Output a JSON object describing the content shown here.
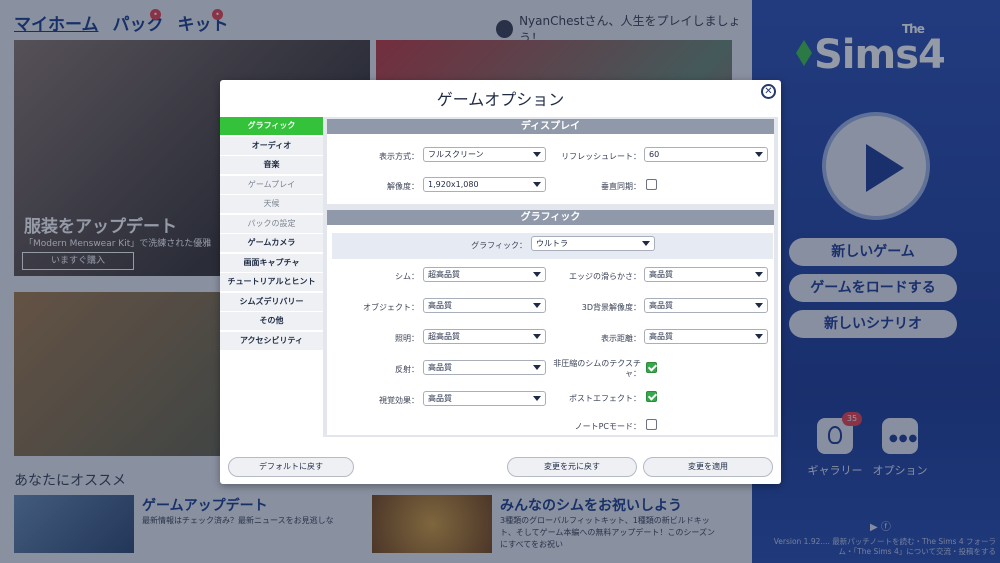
{
  "background": {
    "nav": {
      "home": "マイホーム",
      "packs": "パック",
      "kits": "キット"
    },
    "greeting": "NyanChestさん、人生をプレイしましょう！",
    "tile1": {
      "title": "服装をアップデート",
      "subtitle": "「Modern Menswear Kit」で洗練された優雅",
      "button": "いますぐ購入"
    },
    "recommend_heading": "あなたにオススメ",
    "rec1": {
      "title": "ゲームアップデート",
      "body": "最新情報はチェック済み？最新ニュースをお見逃しな"
    },
    "rec2": {
      "title": "みんなのシムをお祝いしよう",
      "body": "3種類のグローバルフィットキット、1種類の新ビルドキット、そしてゲーム本編への無料アップデート！このシーズンにすべてをお祝い"
    }
  },
  "right_panel": {
    "logo_small": "The",
    "logo": "Sims4",
    "new_game": "新しいゲーム",
    "load_game": "ゲームをロードする",
    "new_scenario": "新しいシナリオ",
    "gallery_label": "ギャラリー",
    "gallery_badge": "35",
    "options_label": "オプション",
    "version_text": "Version 1.92.... 最新パッチノートを読む・The Sims 4 フォーラム・「The Sims 4」について交流・投稿をする"
  },
  "dialog": {
    "title": "ゲームオプション",
    "menu": [
      {
        "label": "グラフィック",
        "state": "selected"
      },
      {
        "label": "オーディオ",
        "state": "normal"
      },
      {
        "label": "音楽",
        "state": "normal"
      },
      {
        "label": "ゲームプレイ",
        "state": "disabled"
      },
      {
        "label": "天候",
        "state": "disabled"
      },
      {
        "label": "パックの設定",
        "state": "disabled"
      },
      {
        "label": "ゲームカメラ",
        "state": "normal"
      },
      {
        "label": "画面キャプチャ",
        "state": "normal"
      },
      {
        "label": "チュートリアルとヒント",
        "state": "normal"
      },
      {
        "label": "シムズデリバリー",
        "state": "normal"
      },
      {
        "label": "その他",
        "state": "normal"
      },
      {
        "label": "アクセシビリティ",
        "state": "normal"
      }
    ],
    "display": {
      "header": "ディスプレイ",
      "mode_label": "表示方式：",
      "mode_value": "フルスクリーン",
      "refresh_label": "リフレッシュレート：",
      "refresh_value": "60",
      "resolution_label": "解像度：",
      "resolution_value": "1,920x1,080",
      "vsync_label": "垂直同期：",
      "vsync_checked": false
    },
    "graphics": {
      "header": "グラフィック",
      "preset_label": "グラフィック：",
      "preset_value": "ウルトラ",
      "sims_label": "シム：",
      "sims_value": "超高品質",
      "edge_label": "エッジの滑らかさ：",
      "edge_value": "高品質",
      "objects_label": "オブジェクト：",
      "objects_value": "高品質",
      "bg3d_label": "3D背景解像度：",
      "bg3d_value": "高品質",
      "lighting_label": "照明：",
      "lighting_value": "超高品質",
      "draw_label": "表示距離：",
      "draw_value": "高品質",
      "reflection_label": "反射：",
      "reflection_value": "高品質",
      "uncompressed_label": "非圧縮のシムのテクスチャ：",
      "uncompressed_checked": true,
      "visual_label": "視覚効果：",
      "visual_value": "高品質",
      "post_label": "ポストエフェクト：",
      "post_checked": true,
      "laptop_label": "ノートPCモード：",
      "laptop_checked": false
    },
    "buttons": {
      "defaults": "デフォルトに戻す",
      "revert": "変更を元に戻す",
      "apply": "変更を適用"
    }
  }
}
